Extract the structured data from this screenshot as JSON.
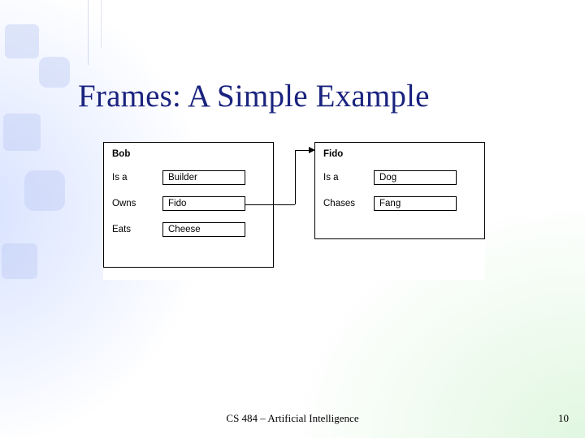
{
  "title": "Frames: A Simple Example",
  "frames": {
    "left": {
      "name": "Bob",
      "slots": [
        {
          "label": "Is a",
          "value": "Builder"
        },
        {
          "label": "Owns",
          "value": "Fido"
        },
        {
          "label": "Eats",
          "value": "Cheese"
        }
      ]
    },
    "right": {
      "name": "Fido",
      "slots": [
        {
          "label": "Is a",
          "value": "Dog"
        },
        {
          "label": "Chases",
          "value": "Fang"
        }
      ]
    }
  },
  "footer": {
    "course": "CS 484 – Artificial Intelligence",
    "page": "10"
  }
}
